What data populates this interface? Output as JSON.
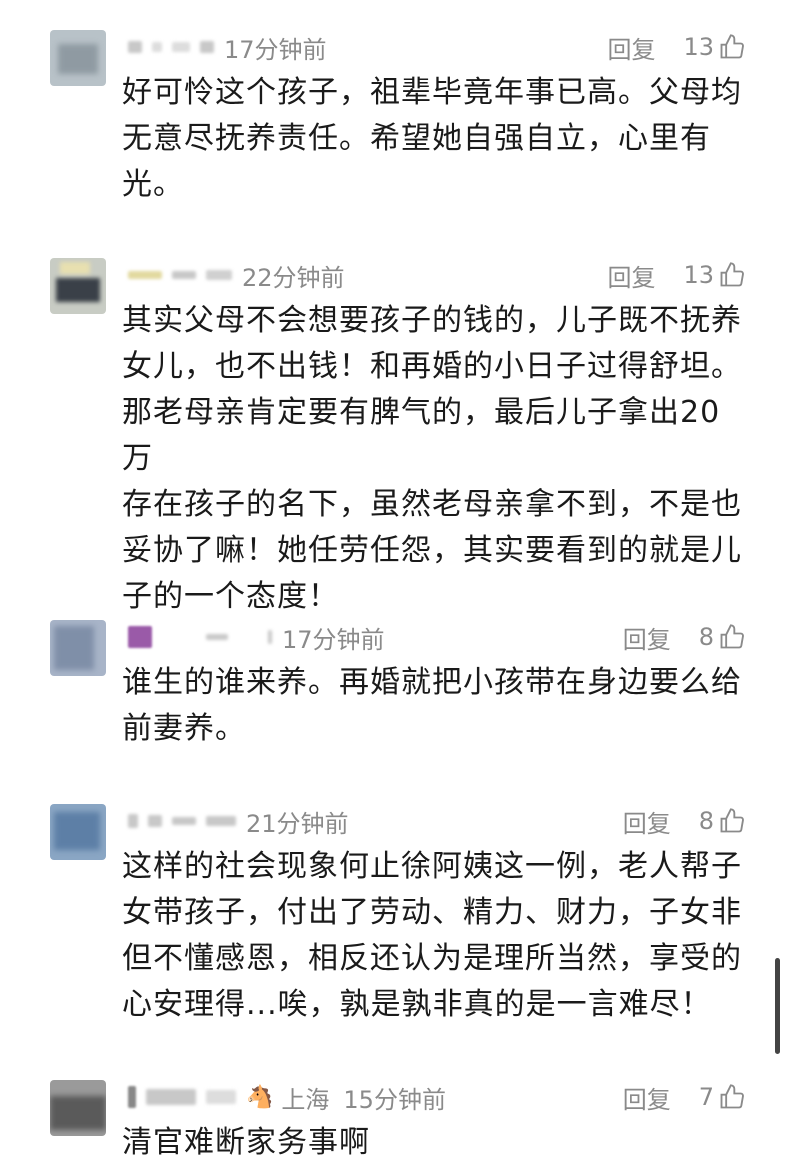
{
  "comments": [
    {
      "time": "17分钟前",
      "reply": "回复",
      "likes": "13",
      "text": "好可怜这个孩子，祖辈毕竟年事已高。父母均\n无意尽抚养责任。希望她自强自立，心里有\n光。"
    },
    {
      "time": "22分钟前",
      "reply": "回复",
      "likes": "13",
      "text": "其实父母不会想要孩子的钱的，儿子既不抚养\n女儿，也不出钱！和再婚的小日子过得舒坦。\n那老母亲肯定要有脾气的，最后儿子拿出20万\n存在孩子的名下，虽然老母亲拿不到，不是也\n妥协了嘛！她任劳任怨，其实要看到的就是儿\n子的一个态度！"
    },
    {
      "time": "17分钟前",
      "reply": "回复",
      "likes": "8",
      "text": "谁生的谁来养。再婚就把小孩带在身边要么给\n前妻养。"
    },
    {
      "time": "21分钟前",
      "reply": "回复",
      "likes": "8",
      "text": "这样的社会现象何止徐阿姨这一例，老人帮子\n女带孩子，付出了劳动、精力、财力，子女非\n但不懂感恩，相反还认为是理所当然，享受的\n心安理得...唉，孰是孰非真的是一言难尽！"
    },
    {
      "location": "上海",
      "time": "15分钟前",
      "reply": "回复",
      "likes": "7",
      "text": "清官难断家务事啊"
    }
  ],
  "icons": {
    "like": "thumbs-up-icon",
    "badge": "horse-icon"
  },
  "colors": {
    "meta": "#8a8a8a",
    "text": "#1a1a1a"
  }
}
